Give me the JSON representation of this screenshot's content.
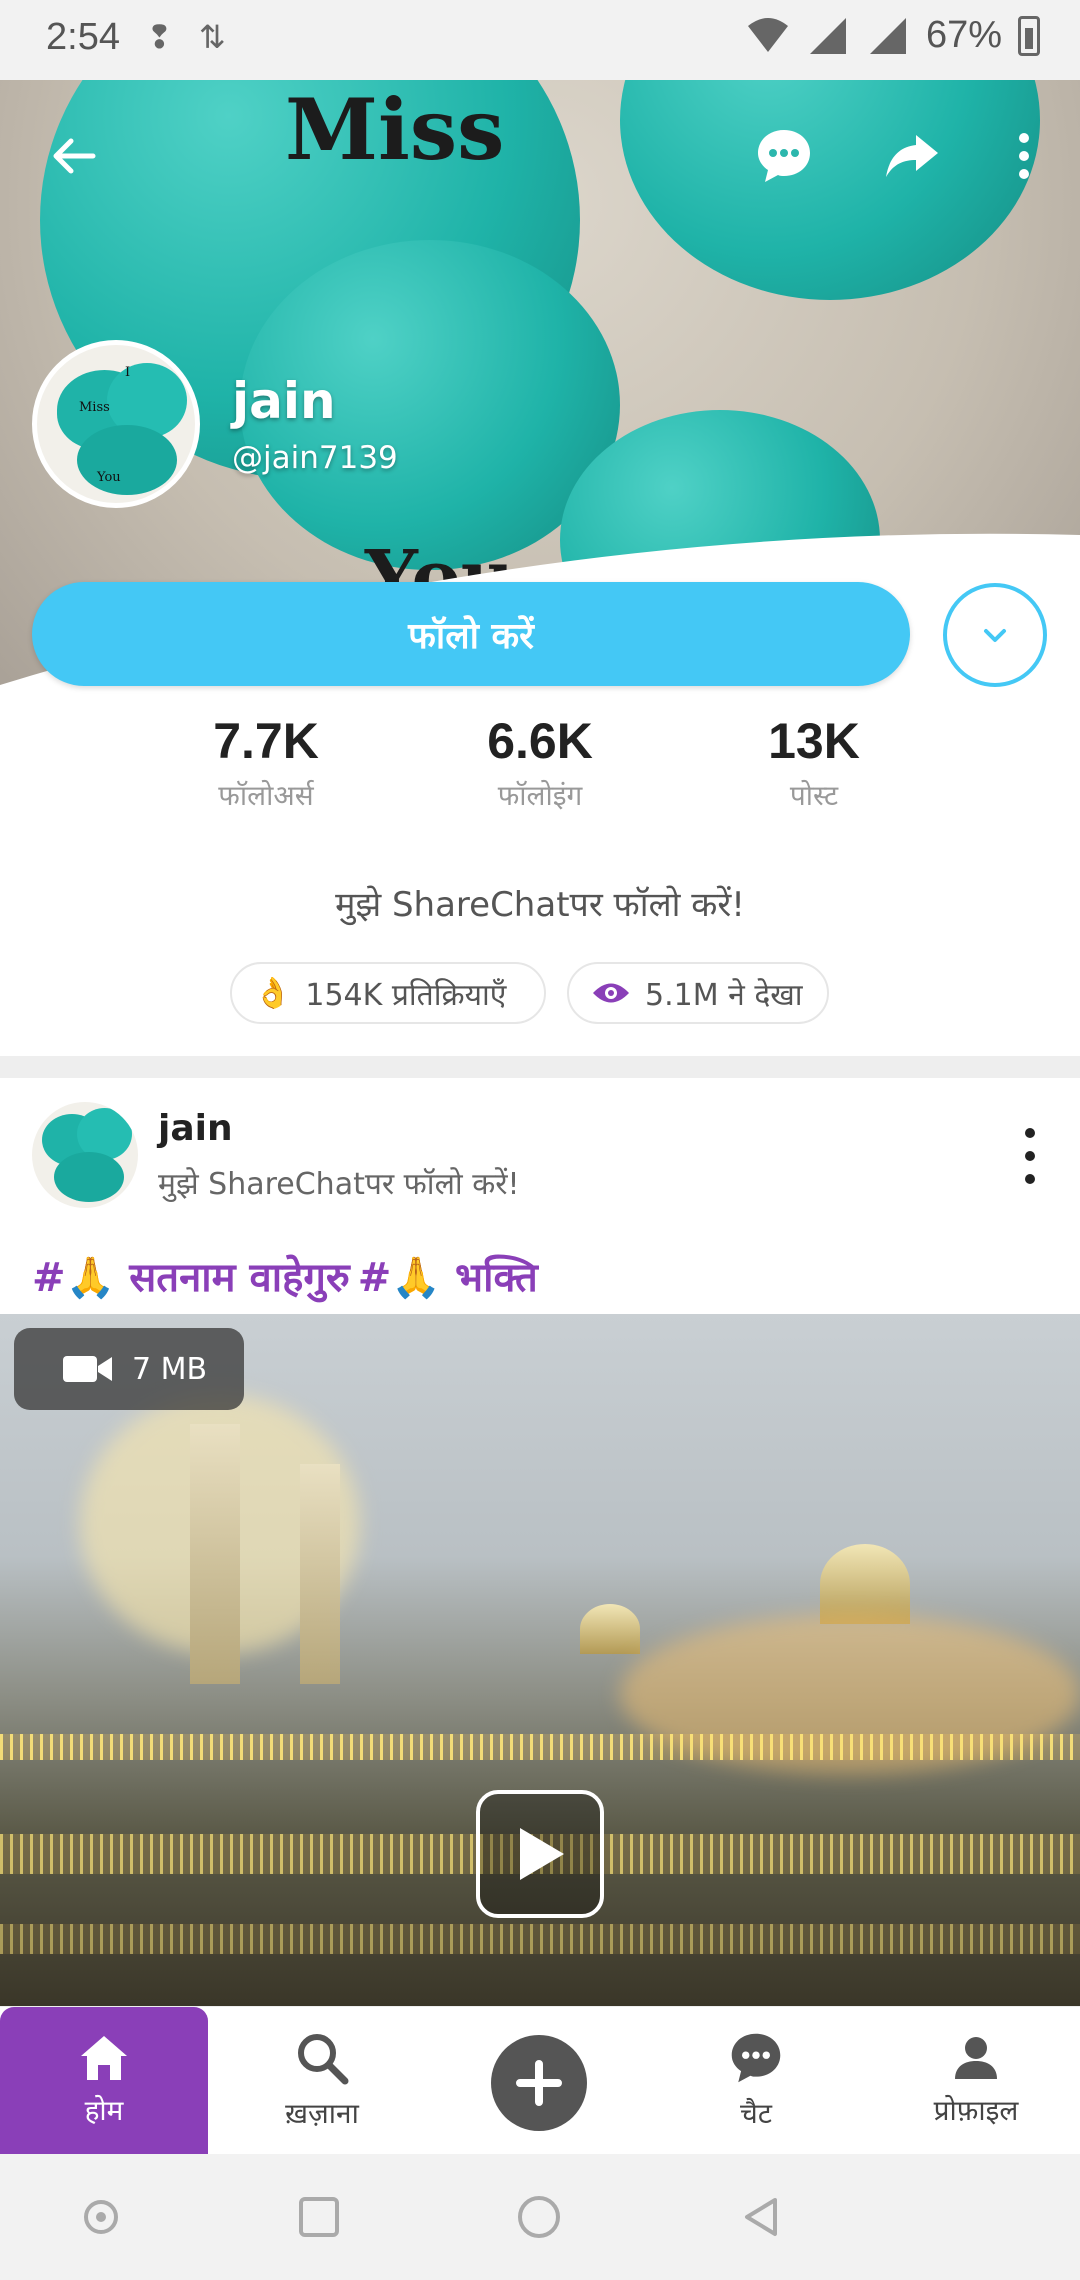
{
  "status_bar": {
    "time": "2:54",
    "battery": "67%"
  },
  "cover": {
    "text_top": "Miss",
    "text_bottom": "You"
  },
  "avatar_text": {
    "line1": "I",
    "line2": "Miss",
    "line3": "You"
  },
  "profile": {
    "name": "jain",
    "handle": "@jain7139"
  },
  "follow": {
    "label": "फॉलो करें"
  },
  "stats": [
    {
      "value": "7.7K",
      "label": "फॉलोअर्स"
    },
    {
      "value": "6.6K",
      "label": "फॉलोइंग"
    },
    {
      "value": "13K",
      "label": "पोस्ट"
    }
  ],
  "bio": "मुझे ShareChatपर फॉलो करें!",
  "chips": {
    "reactions": "154K प्रतिक्रियाएँ",
    "views": "5.1M ने देखा"
  },
  "post": {
    "author": "jain",
    "subtitle": "मुझे ShareChatपर फॉलो करें!",
    "tags": {
      "tag1": "#🙏 सतनाम वाहेगुरु",
      "tag2": "#🙏 भक्ति"
    },
    "media_size": "7 MB"
  },
  "bottom_nav": [
    {
      "label": "होम",
      "icon": "home-icon"
    },
    {
      "label": "ख़ज़ाना",
      "icon": "search-icon"
    },
    {
      "label": "",
      "icon": "plus-icon"
    },
    {
      "label": "चैट",
      "icon": "chat-icon"
    },
    {
      "label": "प्रोफ़ाइल",
      "icon": "person-icon"
    }
  ],
  "colors": {
    "accent_blue": "#44c8f5",
    "accent_purple": "#8a3fb8",
    "icon_dark": "#555555"
  }
}
